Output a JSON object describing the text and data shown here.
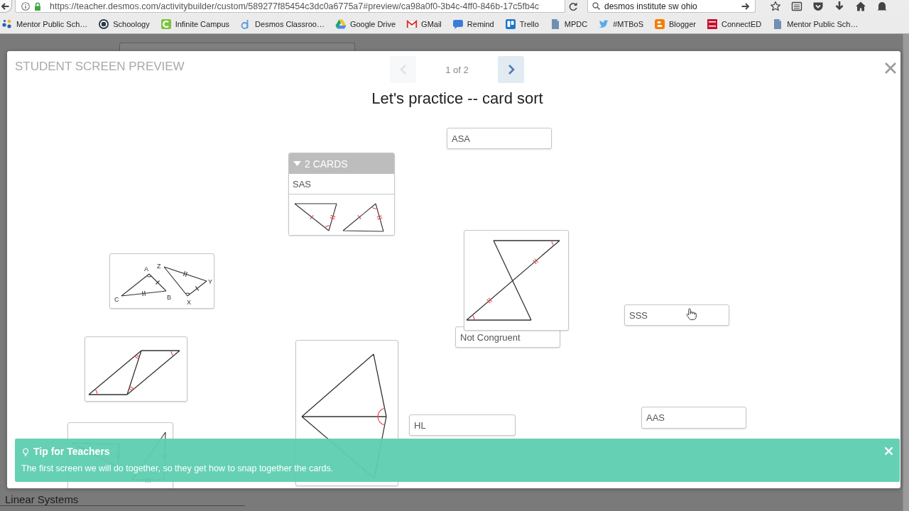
{
  "browser": {
    "url": "https://teacher.desmos.com/activitybuilder/custom/589277f85454c3dc0a6775a7#preview/ca98a0f0-3b4c-4ff0-846b-17c5fb4c",
    "search": "desmos institute sw ohio"
  },
  "bookmarks": [
    {
      "label": "Mentor Public Sch…",
      "kind": "dots"
    },
    {
      "label": "Schoology",
      "kind": "ring"
    },
    {
      "label": "Infinite Campus",
      "kind": "ctile"
    },
    {
      "label": "Desmos Classroo…",
      "kind": "dring"
    },
    {
      "label": "Google Drive",
      "kind": "triangle"
    },
    {
      "label": "GMail",
      "kind": "envelope"
    },
    {
      "label": "Remind",
      "kind": "bubble"
    },
    {
      "label": "Trello",
      "kind": "board"
    },
    {
      "label": "MPDC",
      "kind": "doc"
    },
    {
      "label": "#MTBoS",
      "kind": "bird"
    },
    {
      "label": "Blogger",
      "kind": "btile"
    },
    {
      "label": "ConnectED",
      "kind": "redtile"
    },
    {
      "label": "Mentor Public Sch…",
      "kind": "doc"
    }
  ],
  "preview": {
    "heading": "STUDENT SCREEN PREVIEW",
    "page": "1 of 2",
    "previous_disabled": true,
    "next_disabled": false,
    "title": "Let's practice -- card sort"
  },
  "cards": [
    {
      "kind": "label",
      "text": "ASA"
    },
    {
      "kind": "stack",
      "header": "2 CARDS",
      "expanded": true,
      "label": "SAS"
    },
    {
      "kind": "bowtie"
    },
    {
      "kind": "triangles",
      "labels": [
        "A",
        "Z",
        "Y",
        "C",
        "B",
        "X"
      ]
    },
    {
      "kind": "label",
      "text": "SSS"
    },
    {
      "kind": "label",
      "text": "Not Congruent"
    },
    {
      "kind": "parallelogram"
    },
    {
      "kind": "kite"
    },
    {
      "kind": "label",
      "text": "AAS"
    },
    {
      "kind": "wedge"
    },
    {
      "kind": "label",
      "text": "HL"
    }
  ],
  "tip": {
    "title": "Tip for Teachers",
    "text": "The first screen we will do together, so they get how to snap together the cards."
  },
  "background": {
    "sidebar_item": "Linear Systems"
  }
}
